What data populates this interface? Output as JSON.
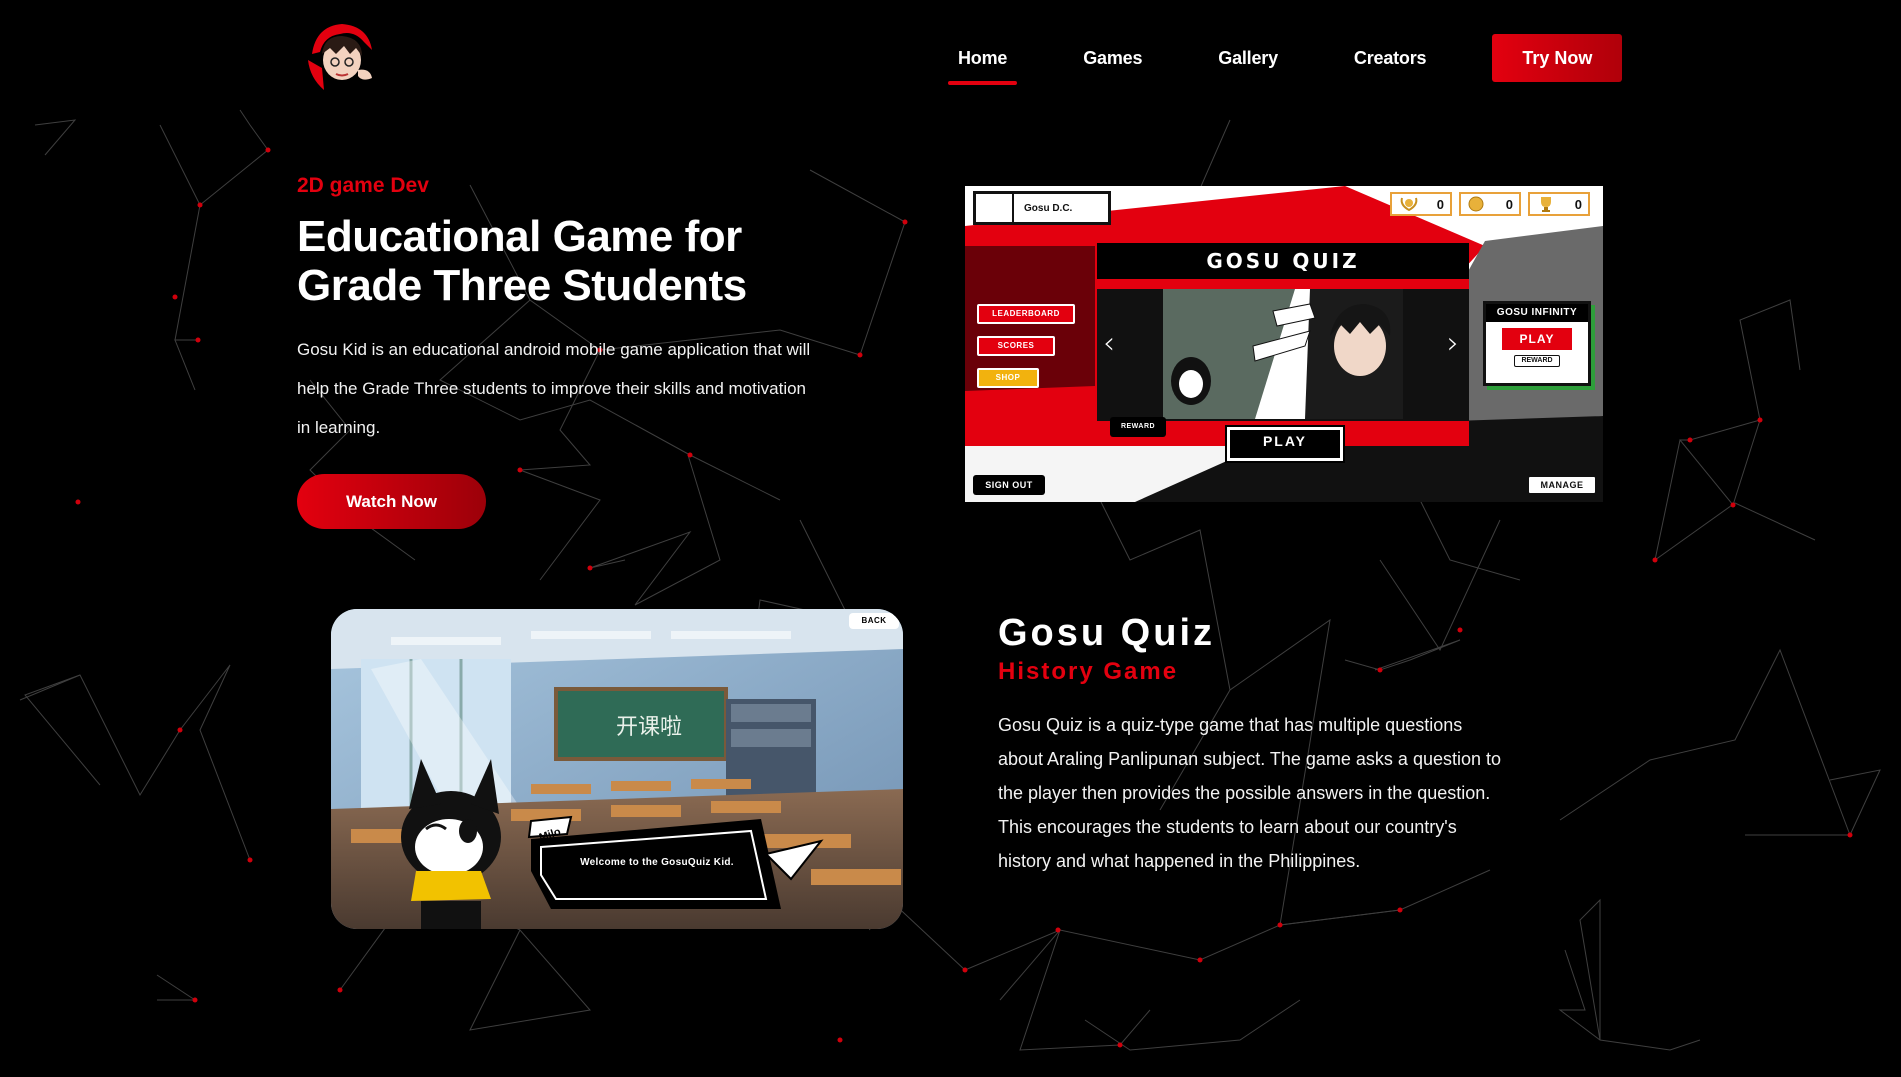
{
  "colors": {
    "accent": "#e3000f",
    "background": "#000000",
    "text": "#ffffff"
  },
  "header": {
    "logo": "gosu-kid-logo",
    "nav": [
      {
        "label": "Home",
        "active": true
      },
      {
        "label": "Games",
        "active": false
      },
      {
        "label": "Gallery",
        "active": false
      },
      {
        "label": "Creators",
        "active": false
      }
    ],
    "cta_label": "Try Now"
  },
  "hero": {
    "eyebrow": "2D game Dev",
    "title": "Educational Game for Grade Three Students",
    "description": "Gosu Kid is an educational android mobile game application that will help the Grade Three students to improve their skills and motivation in learning.",
    "button_label": "Watch Now"
  },
  "game_screen": {
    "player_name": "Gosu D.C.",
    "stats": [
      {
        "icon": "trophy-wreath-icon",
        "value": "0"
      },
      {
        "icon": "coin-icon",
        "value": "0"
      },
      {
        "icon": "trophy-cup-icon",
        "value": "0"
      }
    ],
    "title": "GOSU QUIZ",
    "menu": [
      "LEADERBOARD",
      "SCORES",
      "SHOP"
    ],
    "reward_label": "REWARD",
    "play_label": "PLAY",
    "sign_out_label": "SIGN OUT",
    "manage_label": "MANAGE",
    "infinity": {
      "title": "GOSU INFINITY",
      "play_label": "PLAY",
      "reward_label": "REWARD"
    }
  },
  "quiz_scene": {
    "back_label": "BACK",
    "speaker": "Milo",
    "dialog": "Welcome to the GosuQuiz Kid."
  },
  "quiz": {
    "title": "Gosu Quiz",
    "subtitle": "History Game",
    "description": "Gosu Quiz is a quiz-type game that has multiple questions about Araling Panlipunan subject. The game asks a question to the player then provides the possible answers in the question. This encourages the students to learn about our country's history and what happened in the Philippines."
  }
}
